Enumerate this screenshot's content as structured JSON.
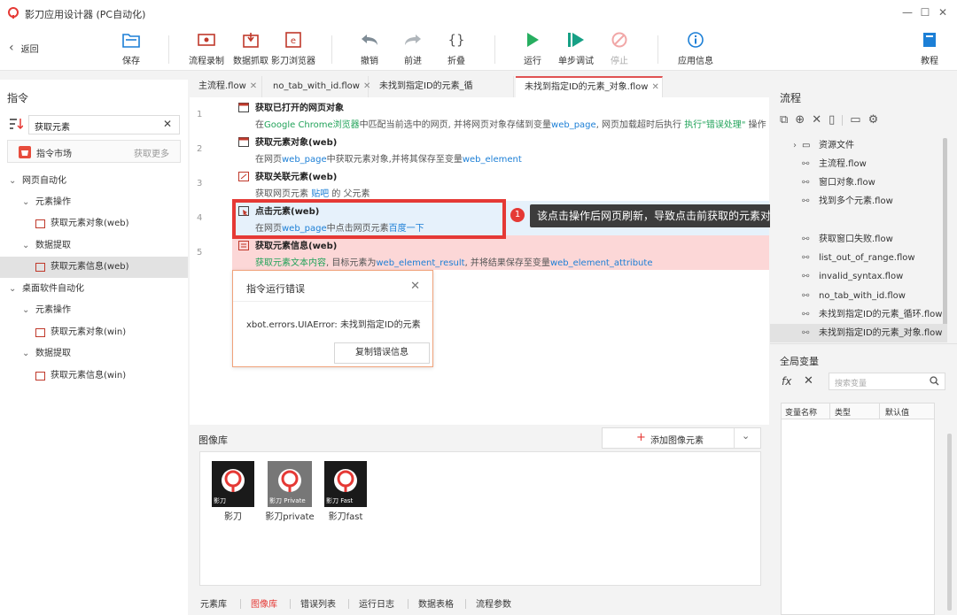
{
  "app": {
    "title": "影刀应用设计器 (PC自动化)"
  },
  "toolbar": {
    "back": "返回",
    "save": "保存",
    "record": "流程录制",
    "scrape": "数据抓取",
    "browser": "影刀浏览器",
    "undo": "撤销",
    "redo": "前进",
    "fold": "折叠",
    "run": "运行",
    "step": "单步调试",
    "stop": "停止",
    "appinfo": "应用信息",
    "tutorial": "教程"
  },
  "left": {
    "title": "指令",
    "search_value": "获取元素",
    "market": "指令市场",
    "market_more": "获取更多",
    "tree": [
      {
        "label": "网页自动化"
      },
      {
        "label": "元素操作"
      },
      {
        "label": "获取元素对象(web)"
      },
      {
        "label": "数据提取"
      },
      {
        "label": "获取元素信息(web)"
      },
      {
        "label": "桌面软件自动化"
      },
      {
        "label": "元素操作"
      },
      {
        "label": "获取元素对象(win)"
      },
      {
        "label": "数据提取"
      },
      {
        "label": "获取元素信息(win)"
      }
    ]
  },
  "tabs": [
    {
      "label": "主流程.flow"
    },
    {
      "label": "no_tab_with_id.flow"
    },
    {
      "label": "未找到指定ID的元素_循环.flow"
    },
    {
      "label": "未找到指定ID的元素_对象.flow"
    }
  ],
  "steps": [
    {
      "num": "1",
      "name": "获取已打开的网页对象",
      "d1": "在",
      "d2": "Google Chrome浏览器",
      "d3": "中匹配当前选中的网页, 并将网页对象存储到变量",
      "d4": "web_page",
      "d5": ", 网页加载超时后执行 ",
      "d6": "执行\"错误处理\"",
      "d7": " 操作"
    },
    {
      "num": "2",
      "name": "获取元素对象(web)",
      "d1": "在网页",
      "d2": "web_page",
      "d3": "中获取元素对象,并将其保存至变量",
      "d4": "web_element"
    },
    {
      "num": "3",
      "name": "获取关联元素(web)",
      "d1": "获取网页元素 ",
      "d2": "贴吧",
      "d3": " 的 父元素"
    },
    {
      "num": "4",
      "name": "点击元素(web)",
      "d1": "在网页",
      "d2": "web_page",
      "d3": "中点击网页元素",
      "d4": "百度一下"
    },
    {
      "num": "5",
      "name": "获取元素信息(web)",
      "d1": "获取元素文本内容",
      "d2": ", 目标元素为",
      "d3": "web_element_result",
      "d4": ", 并将结果保存至变量",
      "d5": "web_element_attribute"
    }
  ],
  "callout": {
    "badge": "1",
    "text": "该点击操作后网页刷新，导致点击前获取的元素对象在点击后找不到元素"
  },
  "error_dialog": {
    "title": "指令运行错误",
    "message": "xbot.errors.UIAError: 未找到指定ID的元素",
    "button": "复制错误信息"
  },
  "image_library": {
    "title": "图像库",
    "add_button": "添加图像元素",
    "images": [
      {
        "label": "影刀",
        "caption": "影刀"
      },
      {
        "label": "影刀private",
        "caption": "影刀 Private"
      },
      {
        "label": "影刀fast",
        "caption": "影刀 Fast"
      }
    ]
  },
  "bottom_tabs": [
    {
      "label": "元素库"
    },
    {
      "label": "图像库"
    },
    {
      "label": "错误列表"
    },
    {
      "label": "运行日志"
    },
    {
      "label": "数据表格"
    },
    {
      "label": "流程参数"
    }
  ],
  "right": {
    "flow_title": "流程",
    "files": [
      {
        "label": "资源文件"
      },
      {
        "label": "主流程.flow"
      },
      {
        "label": "窗口对象.flow"
      },
      {
        "label": "找到多个元素.flow"
      },
      {
        "label": "获取窗口失败.flow"
      },
      {
        "label": "list_out_of_range.flow"
      },
      {
        "label": "invalid_syntax.flow"
      },
      {
        "label": "no_tab_with_id.flow"
      },
      {
        "label": "未找到指定ID的元素_循环.flow"
      },
      {
        "label": "未找到指定ID的元素_对象.flow"
      }
    ],
    "vars_title": "全局变量",
    "var_search_placeholder": "搜索变量",
    "var_columns": [
      "变量名称",
      "类型",
      "默认值"
    ]
  },
  "colors": {
    "accent": "#e53935",
    "link": "#1c7fd6",
    "green": "#22a35a",
    "error_bg": "#fcd7d7"
  }
}
